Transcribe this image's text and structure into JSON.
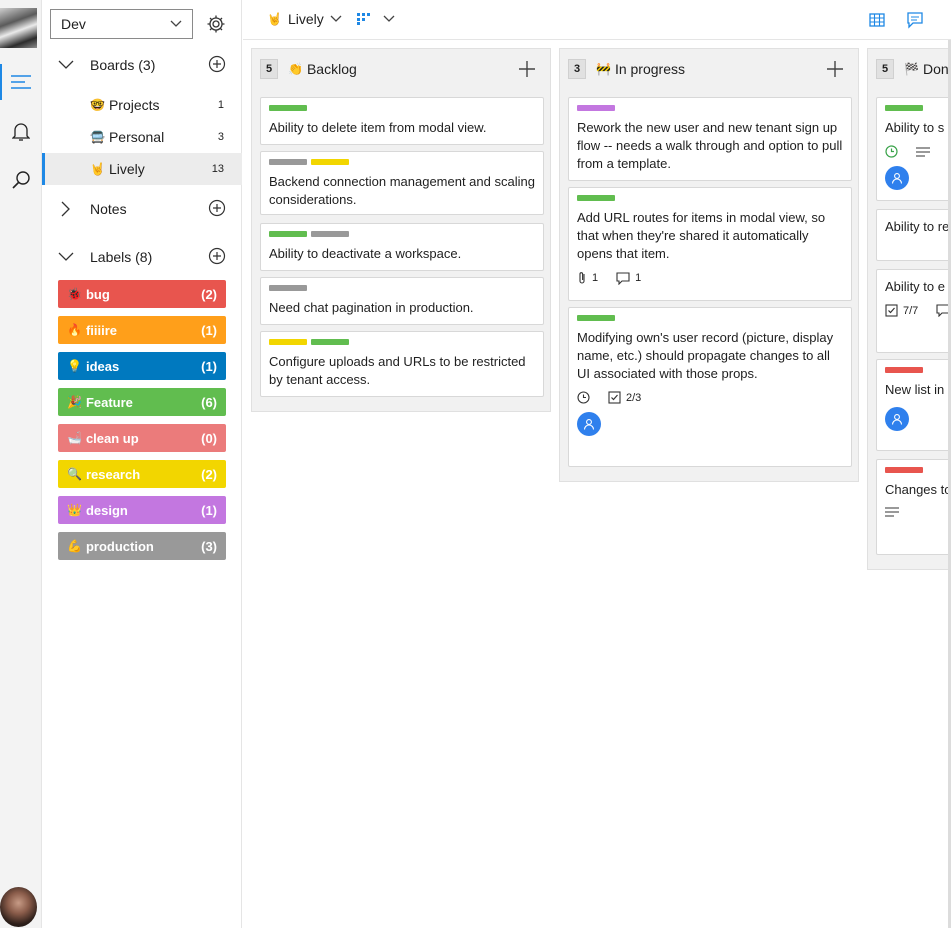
{
  "sidebar": {
    "workspace": "Dev",
    "boards_header": "Boards (3)",
    "boards": [
      {
        "emoji": "🤓",
        "name": "Projects",
        "count": "1"
      },
      {
        "emoji": "🚍",
        "name": "Personal",
        "count": "3"
      },
      {
        "emoji": "🤘",
        "name": "Lively",
        "count": "13"
      }
    ],
    "notes_header": "Notes",
    "labels_header": "Labels (8)",
    "labels": [
      {
        "emoji": "🐞",
        "name": "bug",
        "count": "(2)",
        "color": "#e8554e"
      },
      {
        "emoji": "🔥",
        "name": "fiiiire",
        "count": "(1)",
        "color": "#ff9f1a"
      },
      {
        "emoji": "💡",
        "name": "ideas",
        "count": "(1)",
        "color": "#0079bf"
      },
      {
        "emoji": "🎉",
        "name": "Feature",
        "count": "(6)",
        "color": "#61bd4f"
      },
      {
        "emoji": "🛁",
        "name": "clean up",
        "count": "(0)",
        "color": "#eb7b7b"
      },
      {
        "emoji": "🔍",
        "name": "research",
        "count": "(2)",
        "color": "#f2d600"
      },
      {
        "emoji": "👑",
        "name": "design",
        "count": "(1)",
        "color": "#c377e0"
      },
      {
        "emoji": "💪",
        "name": "production",
        "count": "(3)",
        "color": "#999999"
      }
    ]
  },
  "topbar": {
    "board_emoji": "🤘",
    "board_name": "Lively"
  },
  "columns": [
    {
      "count": "5",
      "emoji": "👏",
      "title": "Backlog",
      "cards": [
        {
          "tags": [
            "#61bd4f"
          ],
          "title": "Ability to delete item from modal view."
        },
        {
          "tags": [
            "#999999",
            "#f2d600"
          ],
          "title": "Backend connection management and scaling considerations."
        },
        {
          "tags": [
            "#61bd4f",
            "#999999"
          ],
          "title": "Ability to deactivate a workspace."
        },
        {
          "tags": [
            "#999999"
          ],
          "title": "Need chat pagination in production."
        },
        {
          "tags": [
            "#f2d600",
            "#61bd4f"
          ],
          "title": "Configure uploads and URLs to be restricted by tenant access."
        }
      ]
    },
    {
      "count": "3",
      "emoji": "🚧",
      "title": "In progress",
      "cards": [
        {
          "tags": [
            "#c377e0"
          ],
          "title": "Rework the new user and new tenant sign up flow -- needs a walk through and option to pull from a template."
        },
        {
          "tags": [
            "#61bd4f"
          ],
          "title": "Add URL routes for items in modal view, so that when they're shared it automatically opens that item.",
          "attachments": "1",
          "comments": "1"
        },
        {
          "tags": [
            "#61bd4f"
          ],
          "title": "Modifying own's user record (picture, display name, etc.) should propagate changes to all UI associated with those props.",
          "checklist": "2/3"
        }
      ]
    },
    {
      "count": "5",
      "emoji": "🏁",
      "title": "Done",
      "cards": [
        {
          "tags": [
            "#61bd4f"
          ],
          "title": "Ability to s"
        },
        {
          "tags": [],
          "title": "Ability to re messages."
        },
        {
          "tags": [],
          "title": "Ability to e messages.",
          "checklist": "7/7"
        },
        {
          "tags": [
            "#e8554e"
          ],
          "title": "New list in auto-expan"
        },
        {
          "tags": [
            "#e8554e"
          ],
          "title": "Changes to updating in"
        }
      ]
    }
  ]
}
